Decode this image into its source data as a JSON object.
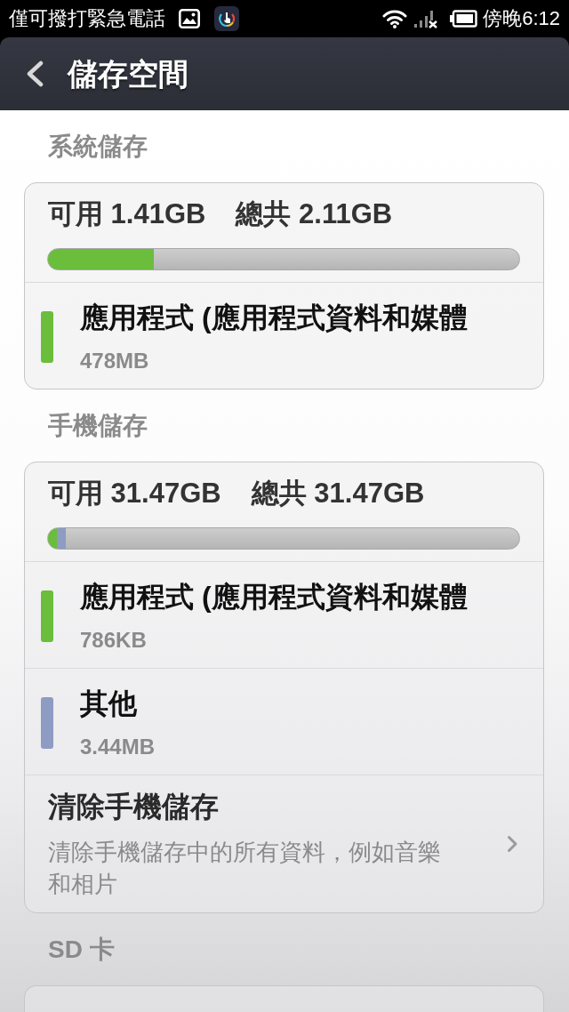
{
  "status_bar": {
    "notification": "僅可撥打緊急電話",
    "time": "傍晚6:12"
  },
  "header": {
    "title": "儲存空間"
  },
  "sections": [
    {
      "title": "系統儲存",
      "available": "可用 1.41GB",
      "total": "總共 2.11GB",
      "segments": [
        {
          "color": "#6bbd3c",
          "level": 0.225
        }
      ],
      "items": [
        {
          "kind": "usage",
          "color": "#6bbd3c",
          "label": "應用程式 (應用程式資料和媒體",
          "size": "478MB"
        }
      ]
    },
    {
      "title": "手機儲存",
      "available": "可用 31.47GB",
      "total": "總共 31.47GB",
      "segments": [
        {
          "color": "#6bbd3c",
          "level": 0.019
        },
        {
          "color": "#8e9bc3",
          "level": 0.019
        }
      ],
      "items": [
        {
          "kind": "usage",
          "color": "#6bbd3c",
          "label": "應用程式 (應用程式資料和媒體",
          "size": "786KB"
        },
        {
          "kind": "usage",
          "color": "#8e9bc3",
          "label": "其他",
          "size": "3.44MB"
        },
        {
          "kind": "action",
          "title": "清除手機儲存",
          "description": "清除手機儲存中的所有資料，例如音樂和相片"
        }
      ]
    },
    {
      "title": "SD 卡"
    }
  ]
}
